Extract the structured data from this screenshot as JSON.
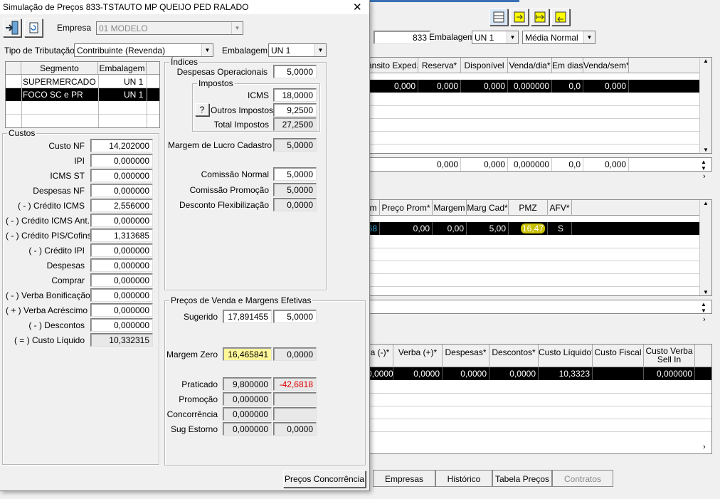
{
  "dialog": {
    "title": "Simulação de Preços  833-TSTAUTO MP QUEIJO PED RALADO",
    "close": "✕"
  },
  "top": {
    "empresa_label": "Empresa",
    "empresa_value": "01 MODELO",
    "tributacao_label": "Tipo de Tributação",
    "tributacao_value": "Contribuinte (Revenda)",
    "embalagem_label": "Embalagem",
    "embalagem_value": "UN  1"
  },
  "segmentos": {
    "headers": [
      "Segmento",
      "Embalagem"
    ],
    "rows": [
      {
        "seg": "SUPERMERCADO",
        "emb": "UN  1"
      },
      {
        "seg": "FOCO SC e PR",
        "emb": "UN  1"
      }
    ]
  },
  "custos": {
    "title": "Custos",
    "items": [
      {
        "label": "Custo NF",
        "value": "14,202000"
      },
      {
        "label": "IPI",
        "value": "0,000000"
      },
      {
        "label": "ICMS ST",
        "value": "0,000000"
      },
      {
        "label": "Despesas NF",
        "value": "0,000000"
      },
      {
        "label": "( - ) Crédito ICMS",
        "value": "2,556000"
      },
      {
        "label": "( - ) Crédito ICMS Ant.",
        "value": "0,000000"
      },
      {
        "label": "( - ) Crédito PIS/Cofins",
        "value": "1,313685"
      },
      {
        "label": "( - ) Crédito IPI",
        "value": "0,000000"
      },
      {
        "label": "Despesas",
        "value": "0,000000"
      },
      {
        "label": "Comprar",
        "value": "0,000000"
      },
      {
        "label": "( - ) Verba Bonificação",
        "value": "0,000000"
      },
      {
        "label": "( + ) Verba Acréscimo",
        "value": "0,000000"
      },
      {
        "label": "( - ) Descontos",
        "value": "0,000000"
      },
      {
        "label": "( = ) Custo Líquido",
        "value": "10,332315"
      }
    ]
  },
  "indices": {
    "title": "Índices",
    "desp_op_label": "Despesas Operacionais",
    "desp_op": "5,0000",
    "impostos_title": "Impostos",
    "icms_label": "ICMS",
    "icms": "18,0000",
    "outros_label": "Outros Impostos",
    "outros": "9,2500",
    "help": "?",
    "total_label": "Total Impostos",
    "total": "27,2500",
    "margem_cad_label": "Margem de Lucro Cadastro",
    "margem_cad": "5,0000",
    "com_normal_label": "Comissão Normal",
    "com_normal": "5,0000",
    "com_promo_label": "Comissão Promoção",
    "com_promo": "5,0000",
    "desc_flex_label": "Desconto Flexibilização",
    "desc_flex": "0,0000"
  },
  "precos": {
    "title": "Preços de Venda e Margens Efetivas",
    "sugerido_label": "Sugerido",
    "sugerido": "17,891455",
    "sugerido_m": "5,0000",
    "mzero_label": "Margem Zero",
    "mzero": "16,465841",
    "mzero_m": "0,0000",
    "praticado_label": "Praticado",
    "praticado": "9,800000",
    "praticado_m": "-42,6818",
    "promocao_label": "Promoção",
    "promocao": "0,000000",
    "promocao_m": "",
    "concorrencia_label": "Concorrência",
    "concorrencia": "0,000000",
    "concorrencia_m": "",
    "sugestorno_label": "Sug Estorno",
    "sugestorno": "0,000000",
    "sugestorno_m": "0,0000"
  },
  "precos_conc_button": "Preços Concorrência",
  "bg": {
    "field833": "833",
    "embalagem_label": "Embalagem",
    "embalagem_value": "UN  1",
    "media_value": "Média Normal",
    "grid1": {
      "headers": [
        "ânsito Exped.*",
        "Reserva*",
        "Disponível",
        "Venda/dia*",
        "Em dias",
        "Venda/sem*"
      ],
      "row": [
        "0,000",
        "0,000",
        "0,000",
        "0,000000",
        "0,0",
        "0,000"
      ],
      "totals": [
        "0,000",
        "0,000",
        "0,000000",
        "0,0",
        "0,000"
      ]
    },
    "grid2": {
      "headers": [
        "m",
        "Preço Prom*",
        "Margem",
        "Marg Cad*",
        "PMZ",
        "AFV*"
      ],
      "row": [
        "68",
        "0,00",
        "0,00",
        "5,00",
        "16,47",
        "S"
      ]
    },
    "grid3": {
      "headers": [
        "a (-)*",
        "Verba (+)*",
        "Despesas*",
        "Descontos*",
        "Custo Líquido*",
        "Custo Fiscal",
        "Custo Verba Sell In"
      ],
      "row": [
        "0,0000",
        "0,0000",
        "0,0000",
        "0,0000",
        "10,3323",
        "",
        "0,000000"
      ]
    },
    "tabs": [
      "Empresas",
      "Histórico",
      "Tabela Preços",
      "Contratos"
    ]
  },
  "colors": {
    "highlight": "#fff79a",
    "negative": "#e00000",
    "selection": "#000000"
  }
}
